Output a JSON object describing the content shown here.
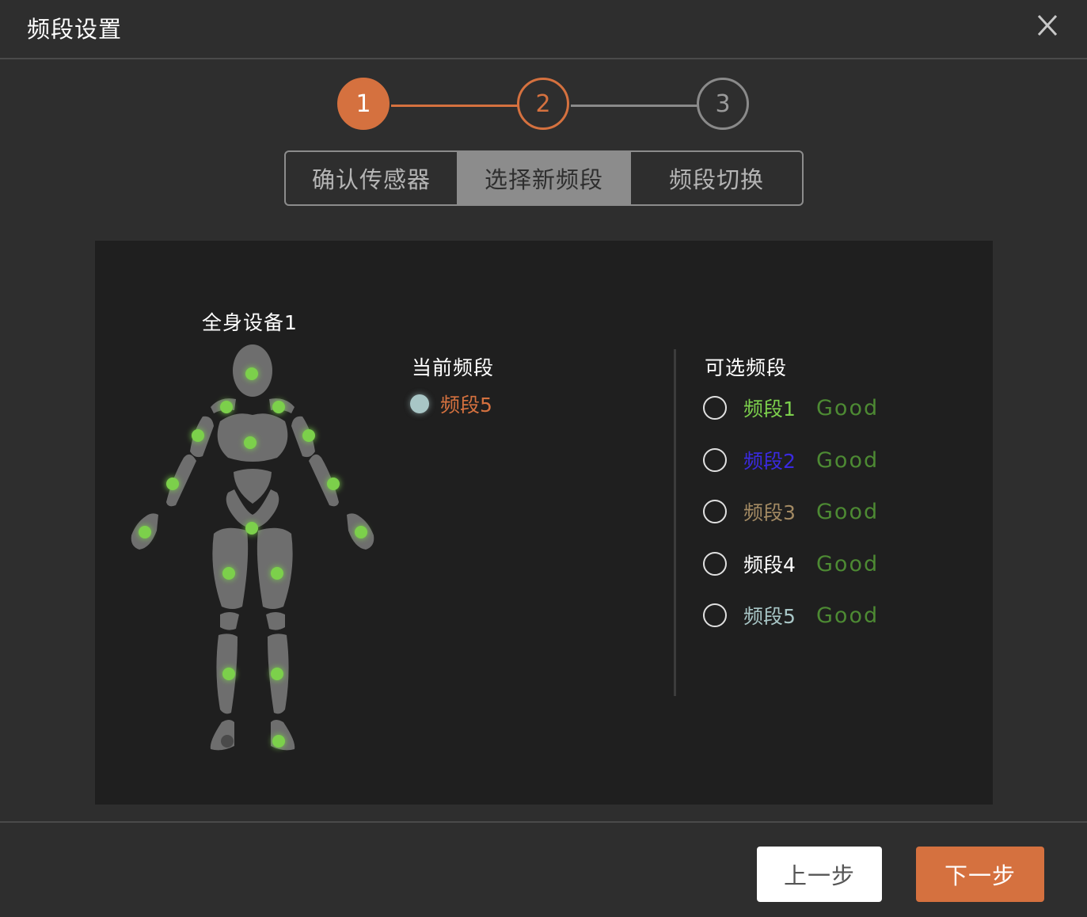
{
  "dialog": {
    "title": "频段设置",
    "close_icon": "close-icon"
  },
  "stepper": {
    "steps": [
      {
        "number": "1",
        "state": "completed"
      },
      {
        "number": "2",
        "state": "current"
      },
      {
        "number": "3",
        "state": "pending"
      }
    ]
  },
  "tabs": [
    {
      "label": "确认传感器",
      "active": false
    },
    {
      "label": "选择新频段",
      "active": true
    },
    {
      "label": "频段切换",
      "active": false
    }
  ],
  "device": {
    "title": "全身设备1",
    "figure_icon": "human-body-figure"
  },
  "current": {
    "label": "当前频段",
    "band": "频段5",
    "dot_color": "#a8c6c6"
  },
  "available": {
    "label": "可选频段",
    "bands": [
      {
        "name": "频段1",
        "quality": "Good",
        "color": "#7cd04c"
      },
      {
        "name": "频段2",
        "quality": "Good",
        "color": "#3a2ae0"
      },
      {
        "name": "频段3",
        "quality": "Good",
        "color": "#a38a63"
      },
      {
        "name": "频段4",
        "quality": "Good",
        "color": "#ffffff"
      },
      {
        "name": "频段5",
        "quality": "Good",
        "color": "#a8c6c6"
      }
    ]
  },
  "footer": {
    "prev_label": "上一步",
    "next_label": "下一步"
  },
  "colors": {
    "accent": "#d5713f",
    "sensor_green": "#7cd04c",
    "quality_green": "#4d8a33"
  }
}
